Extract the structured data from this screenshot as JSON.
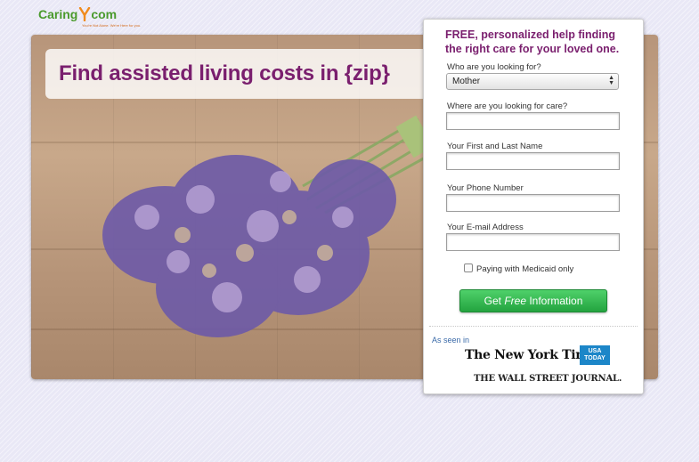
{
  "brand": {
    "logo_prefix": "Caring",
    "logo_suffix": "com",
    "tagline": "You're Not Alone. We're Here for you.",
    "color_primary": "#7a1f6e",
    "color_green": "#4a9a2c"
  },
  "hero": {
    "headline": "Find assisted living costs in {zip}",
    "image": "lavender-bouquet-on-wood"
  },
  "form": {
    "title": "FREE, personalized help finding the right care for your loved one.",
    "who_label": "Who are you looking for?",
    "who_value": "Mother",
    "where_label": "Where are you looking for care?",
    "where_value": "",
    "name_label": "Your First and Last Name",
    "name_value": "",
    "phone_label": "Your Phone Number",
    "phone_value": "",
    "email_label": "Your E-mail Address",
    "email_value": "",
    "medicaid_label": "Paying with Medicaid only",
    "medicaid_checked": false,
    "cta_prefix": "Get ",
    "cta_emphasis": "Free",
    "cta_suffix": " Information",
    "cta_color": "#2bb047"
  },
  "press": {
    "as_seen_in": "As seen in",
    "nyt": "The New York Times",
    "usa_line1": "USA",
    "usa_line2": "TODAY",
    "wsj": "THE WALL STREET JOURNAL."
  }
}
